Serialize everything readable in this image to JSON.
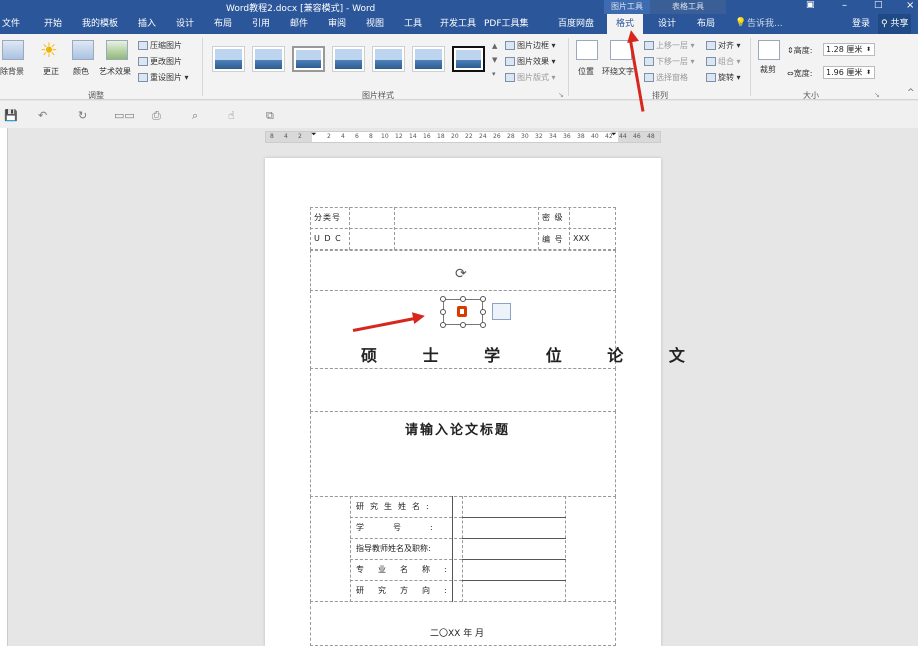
{
  "window": {
    "title": "Word教程2.docx [兼容模式] - Word",
    "ctx_picture_tools": "图片工具",
    "ctx_table_tools": "表格工具"
  },
  "tabs": [
    "文件",
    "开始",
    "我的模板",
    "插入",
    "设计",
    "布局",
    "引用",
    "邮件",
    "审阅",
    "视图",
    "工具",
    "开发工具",
    "PDF工具集",
    "百度网盘",
    "格式",
    "设计",
    "布局"
  ],
  "tell_me": "告诉我...",
  "account": {
    "login": "登录",
    "share": "共享"
  },
  "ribbon": {
    "remove_bg": "除背景",
    "correct": "更正",
    "color": "颜色",
    "art_effect": "艺术效果",
    "compress": "压缩图片",
    "change": "更改图片",
    "reset": "重设图片",
    "group_adjust": "调整",
    "group_styles": "图片样式",
    "border": "图片边框",
    "effect": "图片效果",
    "layout": "图片版式",
    "position": "位置",
    "wrap": "环绕文字",
    "forward": "上移一层",
    "backward": "下移一层",
    "selection_pane": "选择窗格",
    "align": "对齐",
    "group_obj": "组合",
    "rotate": "旋转",
    "group_arrange": "排列",
    "crop": "裁剪",
    "height_label": "高度:",
    "height_value": "1.28 厘米",
    "width_label": "宽度:",
    "width_value": "1.96 厘米",
    "group_size": "大小"
  },
  "ruler_ticks": [
    "8",
    "4",
    "2",
    "2",
    "4",
    "6",
    "8",
    "10",
    "12",
    "14",
    "16",
    "18",
    "20",
    "22",
    "24",
    "26",
    "28",
    "30",
    "32",
    "34",
    "36",
    "38",
    "40",
    "42",
    "44",
    "46",
    "48"
  ],
  "document": {
    "class_no_label": "分类号",
    "secret_label": "密 级",
    "udc_label": "U D C",
    "id_label": "编 号",
    "id_value": "XXX",
    "heading": "硕 士 学 位 论 文",
    "title_prompt": "请输入论文标题",
    "form_rows": [
      "研究生姓名:",
      "学号:",
      "指导教师姓名及职称:",
      "专业名称:",
      "研究方向:"
    ],
    "date": "二〇XX 年   月"
  },
  "colors": {
    "accent": "#2b579a",
    "arrow": "#d7261e",
    "office_logo": "#d83b01"
  }
}
